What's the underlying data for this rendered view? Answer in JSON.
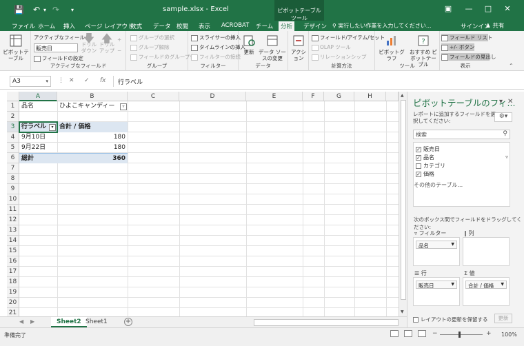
{
  "titlebar": {
    "title": "sample.xlsx - Excel",
    "context_tool": "ピボットテーブル ツール"
  },
  "tabs": [
    "ファイル",
    "ホーム",
    "挿入",
    "ページ レイアウト",
    "数式",
    "データ",
    "校閲",
    "表示",
    "ACROBAT",
    "チーム",
    "分析",
    "デザイン"
  ],
  "active_tab": "分析",
  "tell_me": "実行したい作業を入力してください...",
  "signin": "サインイン",
  "share": "共有",
  "ribbon": {
    "pivottable_button": "ピボットテーブル",
    "active_field_label": "アクティブなフィールド:",
    "active_field_value": "販売日",
    "field_settings": "フィールドの設定",
    "drilldown": "ドリル ダウン",
    "drillup": "ドリルアップ",
    "group_active_field": "アクティブなフィールド",
    "group_selection": "グループの選択",
    "ungroup": "グループ解除",
    "group_field": "フィールドのグループ化",
    "group_group": "グループ",
    "insert_slicer": "スライサーの挿入",
    "insert_timeline": "タイムラインの挿入",
    "filter_connections": "フィルターの接続",
    "group_filter": "フィルター",
    "refresh": "更新",
    "change_source": "データ ソースの変更",
    "group_data": "データ",
    "actions": "アクション",
    "fields_items_sets": "フィールド/アイテム/セット",
    "olap_tools": "OLAP ツール",
    "relationships": "リレーションシップ",
    "group_calc": "計算方法",
    "pivotchart": "ピボットグラフ",
    "recommended": "おすすめ ピボットテーブル",
    "group_tools": "ツール",
    "field_list": "フィールド リスト",
    "buttons": "+/- ボタン",
    "field_headers": "フィールドの見出し",
    "group_show": "表示"
  },
  "formula_bar": {
    "name_box": "A3",
    "formula": "行ラベル",
    "fx": "fx"
  },
  "columns": [
    "A",
    "B",
    "C",
    "D",
    "E",
    "F",
    "G",
    "H"
  ],
  "rows": [
    "1",
    "2",
    "3",
    "4",
    "5",
    "6",
    "7",
    "8",
    "9",
    "10",
    "11",
    "12",
    "13",
    "14",
    "15",
    "16",
    "17",
    "18",
    "19",
    "20",
    "21"
  ],
  "cells": {
    "A1": "品名",
    "B1": "ひよこキャンディー",
    "A3": "行ラベル",
    "B3": "合計 / 価格",
    "A4": "9月10日",
    "B4": "180",
    "A5": "9月22日",
    "B5": "180",
    "A6": "総計",
    "B6": "360"
  },
  "sheets": [
    "Sheet2",
    "Sheet1"
  ],
  "active_sheet": "Sheet2",
  "pane": {
    "title": "ピボットテーブルのフィ...",
    "desc": "レポートに追加するフィールドを選択してください:",
    "search_placeholder": "検索",
    "fields": [
      {
        "label": "販売日",
        "checked": true
      },
      {
        "label": "品名",
        "checked": true
      },
      {
        "label": "カテゴリ",
        "checked": false
      },
      {
        "label": "価格",
        "checked": true
      }
    ],
    "other_tables": "その他のテーブル...",
    "drag_tip": "次のボックス間でフィールドをドラッグしてください:",
    "zone_filter": "フィルター",
    "zone_filter_item": "品名",
    "zone_columns": "列",
    "zone_rows": "行",
    "zone_rows_item": "販売日",
    "zone_values": "値",
    "zone_values_item": "合計 / 価格",
    "defer": "レイアウトの更新を保留する",
    "update": "更新"
  },
  "status": {
    "ready": "準備完了",
    "zoom": "100%"
  }
}
